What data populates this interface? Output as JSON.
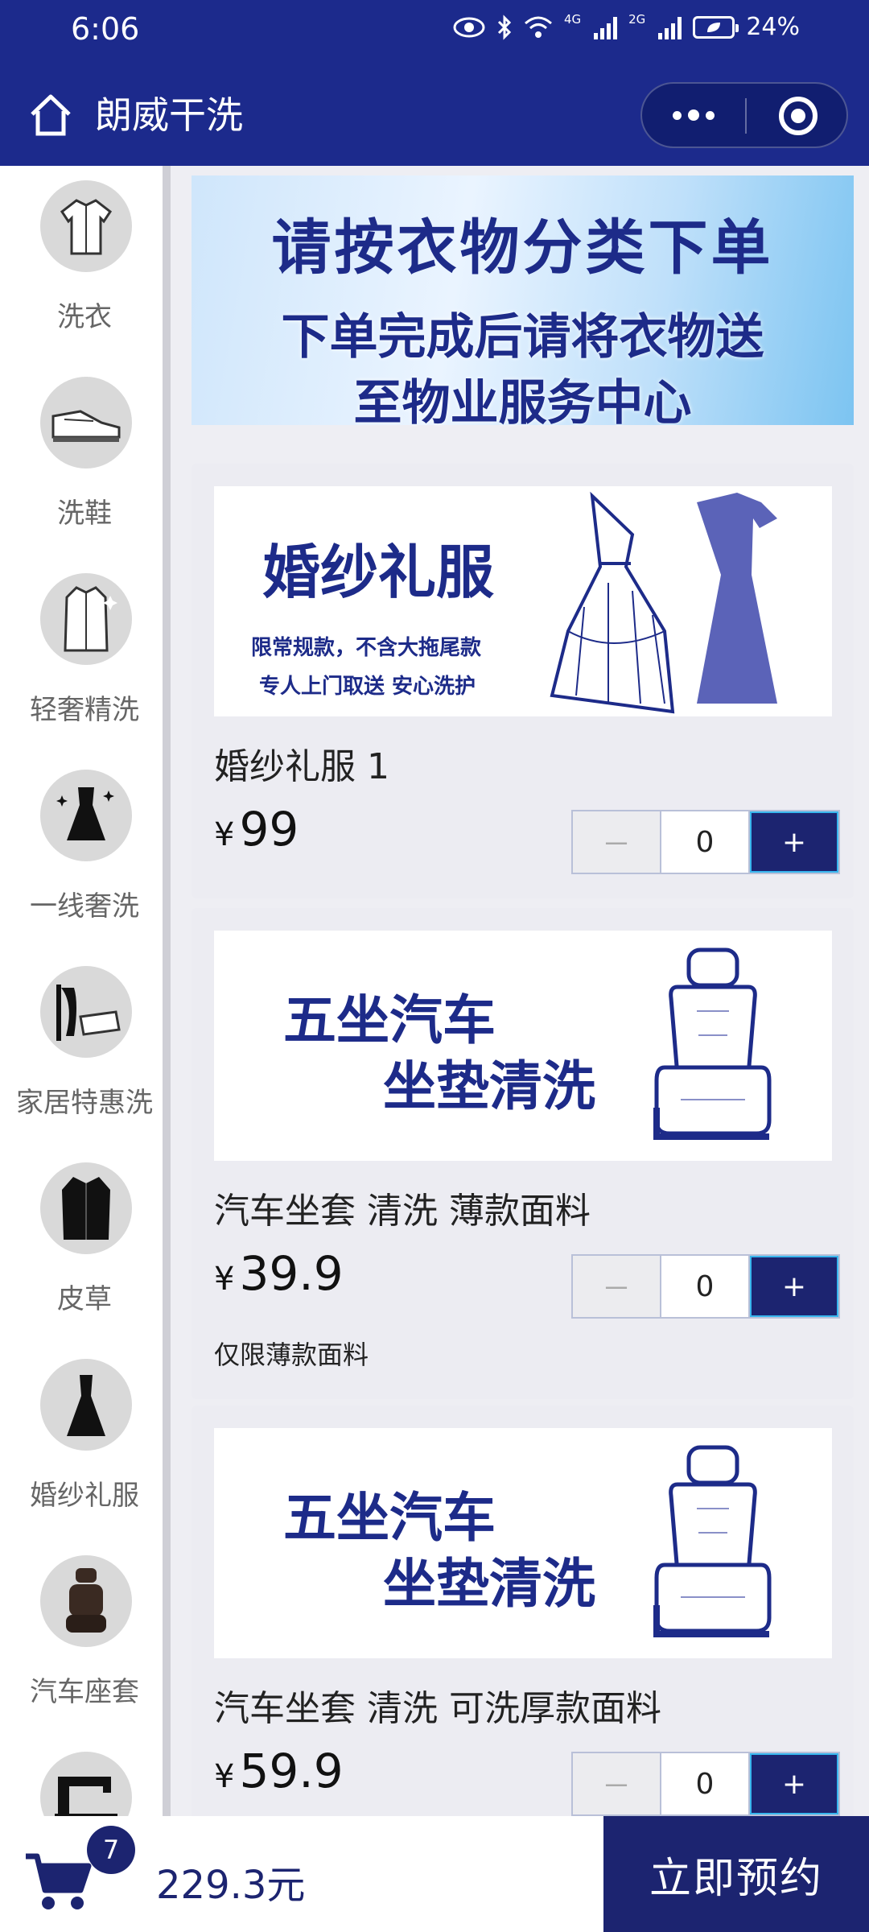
{
  "status_bar": {
    "time": "6:06",
    "net1": "4G",
    "net2": "2G",
    "battery": "24%"
  },
  "navbar": {
    "title": "朗威干洗"
  },
  "sidebar": {
    "items": [
      {
        "label": "洗衣",
        "icon": "shirt-icon"
      },
      {
        "label": "洗鞋",
        "icon": "shoe-icon"
      },
      {
        "label": "轻奢精洗",
        "icon": "coat-icon"
      },
      {
        "label": "一线奢洗",
        "icon": "dress-icon"
      },
      {
        "label": "家居特惠洗",
        "icon": "curtain-icon"
      },
      {
        "label": "皮草",
        "icon": "fur-coat-icon"
      },
      {
        "label": "婚纱礼服",
        "icon": "gown-icon"
      },
      {
        "label": "汽车座套",
        "icon": "car-seat-icon"
      },
      {
        "label": "",
        "icon": "sewing-machine-icon"
      }
    ]
  },
  "banner": {
    "line1": "请按衣物分类下单",
    "line2": "下单完成后请将衣物送",
    "line3": "至物业服务中心"
  },
  "products": [
    {
      "name": "婚纱礼服 1",
      "currency": "¥",
      "price": "99",
      "qty": "0",
      "minus": "－",
      "plus": "+",
      "note": "",
      "image": {
        "title": "婚纱礼服",
        "sub1": "限常规款，不含大拖尾款",
        "sub2": "专人上门取送 安心洗护"
      }
    },
    {
      "name": "汽车坐套 清洗 薄款面料",
      "currency": "¥",
      "price": "39.9",
      "qty": "0",
      "minus": "－",
      "plus": "+",
      "note": "仅限薄款面料",
      "image": {
        "title1": "五坐汽车",
        "title2": "坐垫清洗"
      }
    },
    {
      "name": "汽车坐套 清洗 可洗厚款面料",
      "currency": "¥",
      "price": "59.9",
      "qty": "0",
      "minus": "－",
      "plus": "+",
      "note": "",
      "image": {
        "title1": "五坐汽车",
        "title2": "坐垫清洗"
      }
    }
  ],
  "cart": {
    "count": "7",
    "total": "229.3元"
  },
  "book_button": "立即预约",
  "colors": {
    "primary": "#1c2a8c",
    "accent_dark": "#1c2470",
    "stepper_border": "#38b6ee"
  }
}
